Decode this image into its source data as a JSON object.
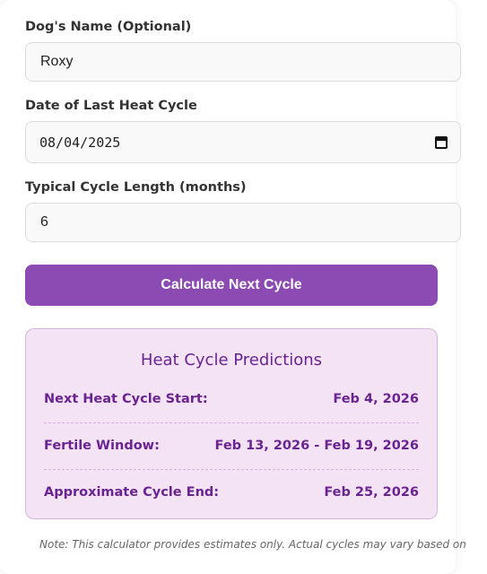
{
  "form": {
    "name_label": "Dog's Name (Optional)",
    "name_value": "Roxy",
    "date_label": "Date of Last Heat Cycle",
    "date_value": "08/04/2025",
    "cycle_label": "Typical Cycle Length (months)",
    "cycle_value": "6",
    "submit_label": "Calculate Next Cycle"
  },
  "results": {
    "title": "Heat Cycle Predictions",
    "rows": [
      {
        "label": "Next Heat Cycle Start:",
        "value": "Feb 4, 2026"
      },
      {
        "label": "Fertile Window:",
        "value": "Feb 13, 2026 - Feb 19, 2026"
      },
      {
        "label": "Approximate Cycle End:",
        "value": "Feb 25, 2026"
      }
    ]
  },
  "note": "Note: This calculator provides estimates only. Actual cycles may vary based on",
  "colors": {
    "accent": "#8b4bb3",
    "results_bg": "#f3e3f4",
    "results_text": "#6b2391"
  }
}
